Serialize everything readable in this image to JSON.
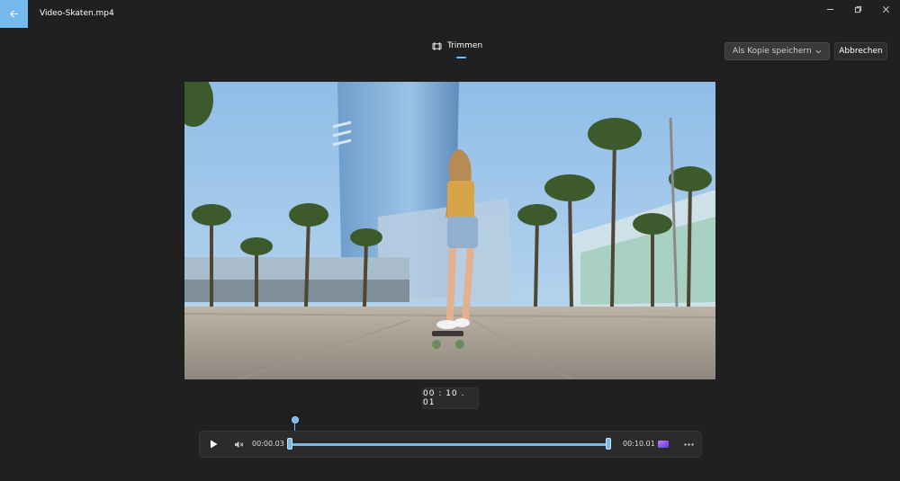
{
  "window": {
    "title": "Video-Skaten.mp4",
    "icons": {
      "back": "back-arrow-icon",
      "minimize": "minimize-icon",
      "restore": "restore-icon",
      "close": "close-icon"
    }
  },
  "toolbar": {
    "mode_label": "Trimmen",
    "mode_icon": "trim-icon",
    "save_label": "Als Kopie speichern",
    "cancel_label": "Abbrechen"
  },
  "player": {
    "current_time": "00 : 10 . 01",
    "trim_start": "00:00.03",
    "trim_end": "00:10.01",
    "icons": {
      "play": "play-icon",
      "mute": "mute-icon",
      "clipchamp": "clipchamp-icon",
      "more": "more-icon"
    }
  },
  "colors": {
    "accent": "#76b9ed",
    "background": "#202020"
  }
}
